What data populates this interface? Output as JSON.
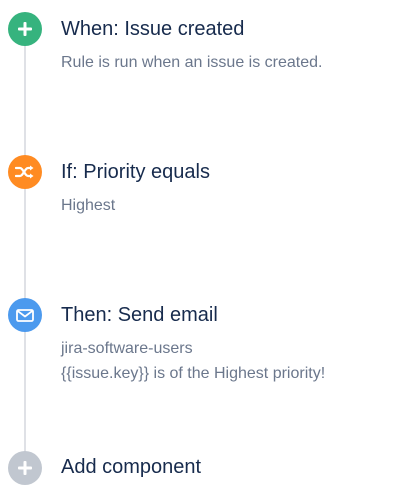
{
  "colors": {
    "trigger": "#36b37e",
    "condition": "#ff8b22",
    "action": "#4c9aee",
    "add": "#c1c7d0",
    "line": "#dfe1e6",
    "title": "#172b4d",
    "description": "#6b778c"
  },
  "steps": {
    "trigger": {
      "icon": "plus-icon",
      "title": "When: Issue created",
      "description": "Rule is run when an issue is created."
    },
    "condition": {
      "icon": "shuffle-icon",
      "title": "If: Priority equals",
      "description": "Highest"
    },
    "action": {
      "icon": "envelope-icon",
      "title": "Then: Send email",
      "description_line1": "jira-software-users",
      "description_line2": "{{issue.key}} is of the Highest priority!"
    },
    "add": {
      "icon": "plus-icon",
      "title": "Add component"
    }
  }
}
